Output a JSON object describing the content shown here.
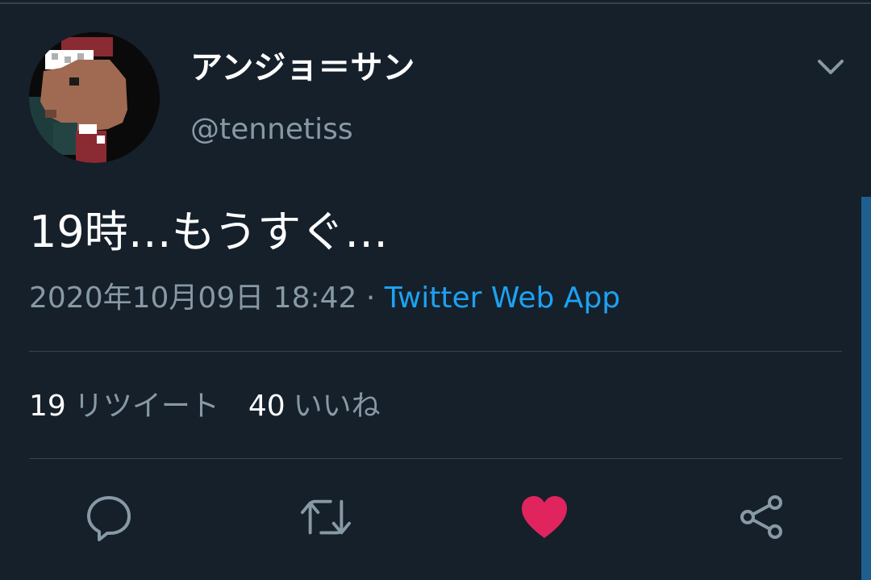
{
  "tweet": {
    "display_name": "アンジョ＝サン",
    "handle": "@tennetiss",
    "text": "19時…もうすぐ…",
    "timestamp": "2020年10月09日 18:42",
    "separator": " · ",
    "source": "Twitter Web App"
  },
  "stats": {
    "retweets_count": "19",
    "retweets_label": "リツイート",
    "likes_count": "40",
    "likes_label": "いいね"
  },
  "actions": [
    {
      "icon": "reply-icon"
    },
    {
      "icon": "retweet-icon"
    },
    {
      "icon": "heart-icon",
      "active": true
    },
    {
      "icon": "share-icon"
    }
  ],
  "colors": {
    "background": "#15202b",
    "text_primary": "#ffffff",
    "text_secondary": "#8899a6",
    "link": "#1da1f2",
    "like_active": "#e0245e",
    "divider": "#38444d"
  }
}
